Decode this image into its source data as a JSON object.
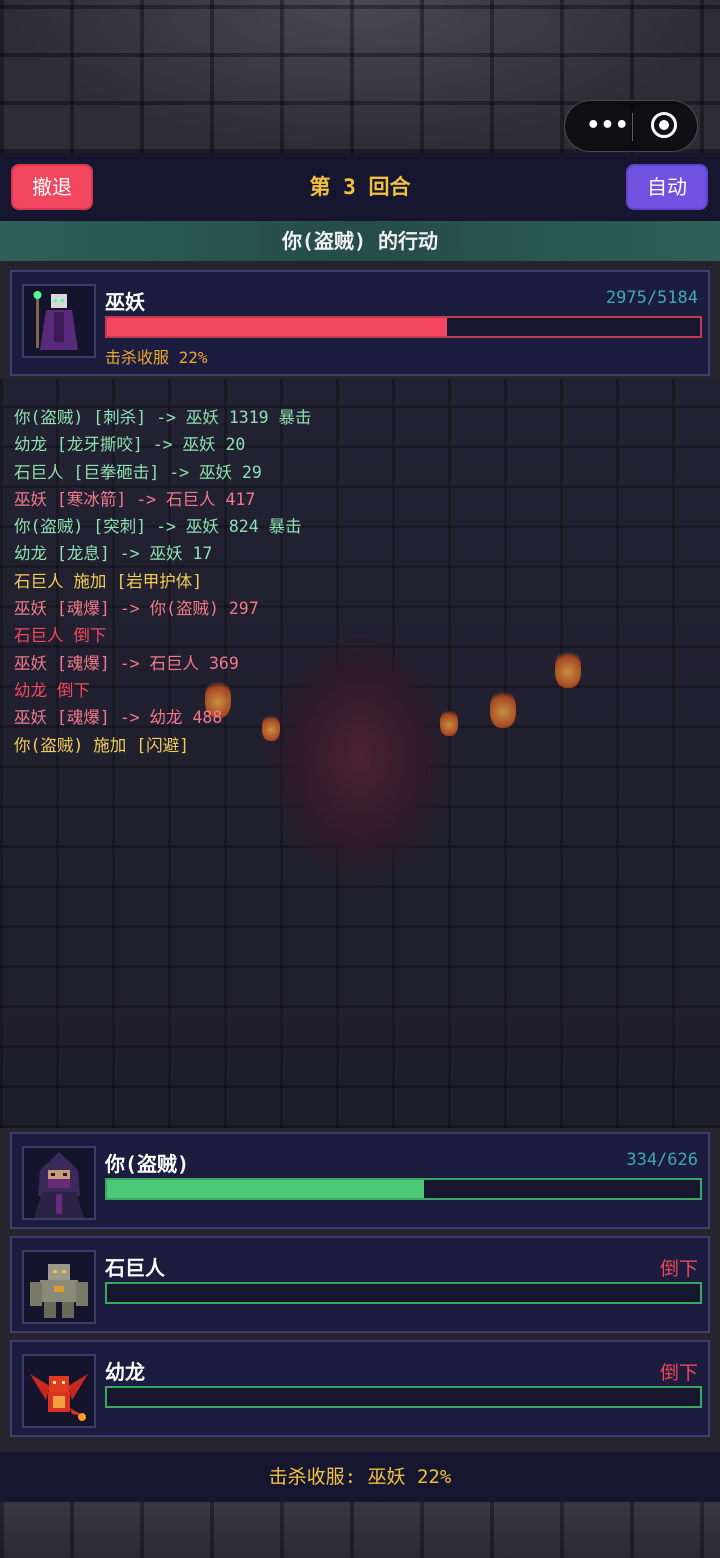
{
  "header": {
    "retreat_label": "撤退",
    "round_title": "第 3 回合",
    "auto_label": "自动",
    "turn_banner": "你(盗贼) 的行动"
  },
  "boss": {
    "name": "巫妖",
    "hp_text": "2975/5184",
    "hp_fraction": 0.574,
    "capture_text": "击杀收服 22%"
  },
  "battle_log": [
    {
      "text": "你(盗贼) [刺杀] -> 巫妖 1319 暴击",
      "kind": "ally"
    },
    {
      "text": "幼龙 [龙牙撕咬] -> 巫妖 20",
      "kind": "ally"
    },
    {
      "text": "石巨人 [巨拳砸击] -> 巫妖 29",
      "kind": "ally"
    },
    {
      "text": "巫妖 [寒冰箭] -> 石巨人 417",
      "kind": "enemy"
    },
    {
      "text": "你(盗贼) [突刺] -> 巫妖 824 暴击",
      "kind": "ally"
    },
    {
      "text": "幼龙 [龙息] -> 巫妖 17",
      "kind": "ally"
    },
    {
      "text": "石巨人 施加 [岩甲护体]",
      "kind": "buff"
    },
    {
      "text": "巫妖 [魂爆] -> 你(盗贼) 297",
      "kind": "enemy"
    },
    {
      "text": "石巨人 倒下",
      "kind": "down"
    },
    {
      "text": "巫妖 [魂爆] -> 石巨人 369",
      "kind": "enemy"
    },
    {
      "text": "幼龙 倒下",
      "kind": "down"
    },
    {
      "text": "巫妖 [魂爆] -> 幼龙 488",
      "kind": "enemy"
    },
    {
      "text": "你(盗贼) 施加 [闪避]",
      "kind": "buff"
    }
  ],
  "party": [
    {
      "name": "你(盗贼)",
      "status": "334/626",
      "hp_fraction": 0.534,
      "down": false
    },
    {
      "name": "石巨人",
      "status": "倒下",
      "hp_fraction": 0,
      "down": true
    },
    {
      "name": "幼龙",
      "status": "倒下",
      "hp_fraction": 0,
      "down": true
    }
  ],
  "footer": {
    "capture_summary": "击杀收服: 巫妖 22%"
  },
  "colors": {
    "retreat": "#f2455e",
    "auto": "#7152e0",
    "title_gold": "#f0c040",
    "enemy_hp": "#f2455e",
    "ally_hp": "#4cc877"
  },
  "icons": {
    "capsule_more": "more-dots-icon",
    "capsule_close": "target-close-icon"
  }
}
